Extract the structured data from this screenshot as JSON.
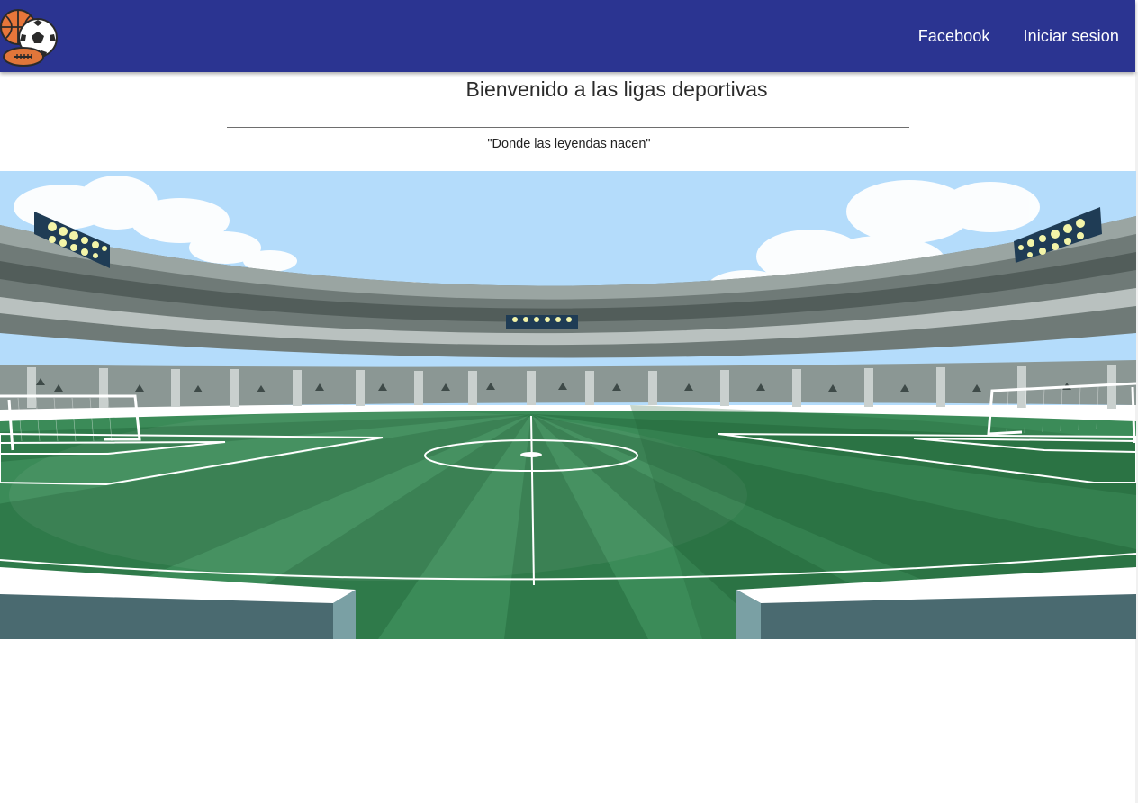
{
  "navbar": {
    "background": "#2b3491",
    "logo_icon": "sports-balls-logo-icon",
    "links": [
      {
        "label": "Facebook"
      },
      {
        "label": "Iniciar sesion"
      }
    ]
  },
  "main": {
    "title": "Bienvenido a las ligas deportivas",
    "tagline": "\"Donde las leyendas nacen\"",
    "hero_image": "stadium-illustration"
  },
  "colors": {
    "sky": "#b3dafb",
    "field": "#3a8a57",
    "stands": "#5a6a66"
  }
}
